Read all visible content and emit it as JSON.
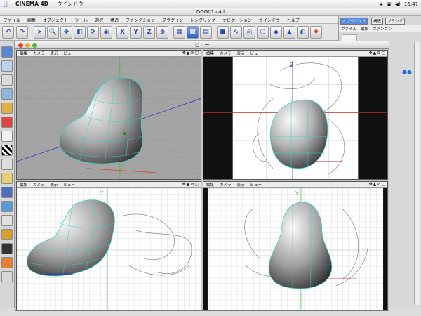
{
  "menubar": {
    "app": "CINEMA 4D",
    "window": "ウインドウ",
    "clock": "16:47"
  },
  "title": "DOG01.c4d",
  "docmenu": [
    "ファイル",
    "編集",
    "オブジェクト",
    "ツール",
    "選択",
    "構造",
    "ファンクション",
    "プラグイン",
    "レンダリング",
    "ナビゲーション",
    "ウインドウ",
    "ヘルプ"
  ],
  "toolbar": {
    "x": "X",
    "y": "Y",
    "z": "Z"
  },
  "viewwin": {
    "title": "ビュー"
  },
  "viewport_menu": [
    "編集",
    "カメラ",
    "表示",
    "ビュー"
  ],
  "viewports": {
    "front_axis": "Z",
    "bottom_left_axis": "Y",
    "bottom_right_axis": "Y"
  },
  "rightpanel": {
    "tabs": [
      "オブジェクト",
      "構造",
      "ブラウザ"
    ],
    "menu": [
      "ファイル",
      "編集",
      "ファンクシ"
    ]
  },
  "colors": {
    "mesh": "#33d2c4",
    "sketch": "#5a4a55",
    "bg_dark": "#111111"
  }
}
